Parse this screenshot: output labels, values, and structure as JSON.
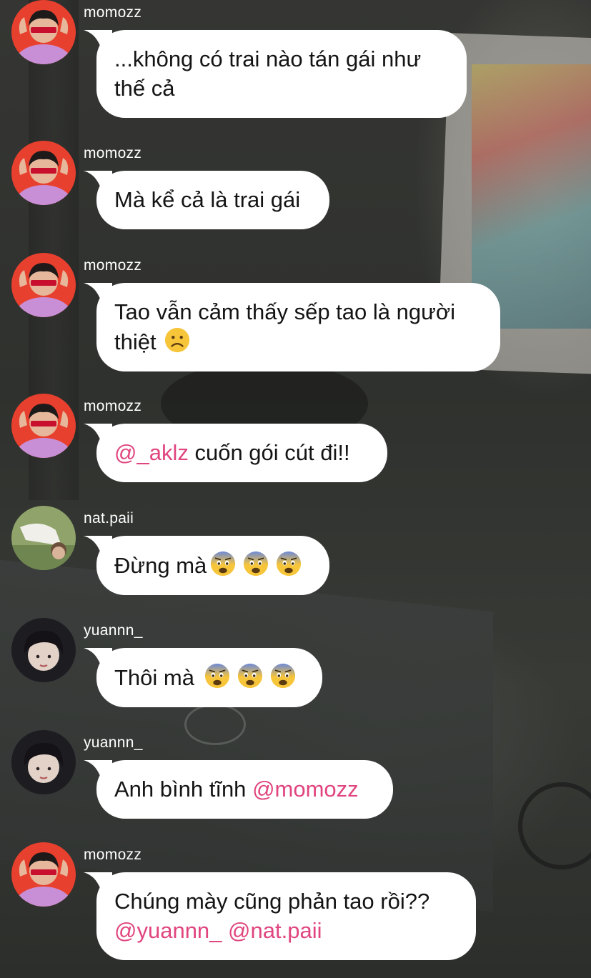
{
  "messages": [
    {
      "username": "momozz",
      "avatar": "momozz-avatar",
      "lines": [
        {
          "text": "...không có trai nào tán gái như"
        },
        {
          "text": "thế cả"
        }
      ]
    },
    {
      "username": "momozz",
      "avatar": "momozz-avatar",
      "lines": [
        {
          "text": "Mà kể cả là trai gái"
        }
      ]
    },
    {
      "username": "momozz",
      "avatar": "momozz-avatar",
      "lines": [
        {
          "text": "Tao vẫn cảm thấy sếp tao là người"
        },
        {
          "text": "thiệt",
          "emoji": [
            "frowning-face-emoji"
          ]
        }
      ]
    },
    {
      "username": "momozz",
      "avatar": "momozz-avatar",
      "lines": [
        {
          "mention": "@_aklz",
          "text": "cuốn gói cút đi!!"
        }
      ]
    },
    {
      "username": "nat.paii",
      "avatar": "nat-paii-avatar",
      "lines": [
        {
          "text": "Đừng mà",
          "emoji": [
            "fearful-face-emoji",
            "fearful-face-emoji",
            "fearful-face-emoji"
          ]
        }
      ]
    },
    {
      "username": "yuannn_",
      "avatar": "yuannn-avatar",
      "lines": [
        {
          "text": "Thôi mà",
          "emoji": [
            "fearful-face-emoji",
            "fearful-face-emoji",
            "fearful-face-emoji"
          ]
        }
      ]
    },
    {
      "username": "yuannn_",
      "avatar": "yuannn-avatar",
      "lines": [
        {
          "text": "Anh bình tĩnh",
          "mention_after": "@momozz"
        }
      ]
    },
    {
      "username": "momozz",
      "avatar": "momozz-avatar",
      "lines": [
        {
          "text": "Chúng mày cũng phản tao rồi??"
        },
        {
          "mentions": [
            "@yuannn_",
            "@nat.paii"
          ]
        }
      ]
    }
  ],
  "colors": {
    "bubble": "#ffffff",
    "text": "#141414",
    "username": "#ffffff",
    "mention": "#e0457f"
  }
}
